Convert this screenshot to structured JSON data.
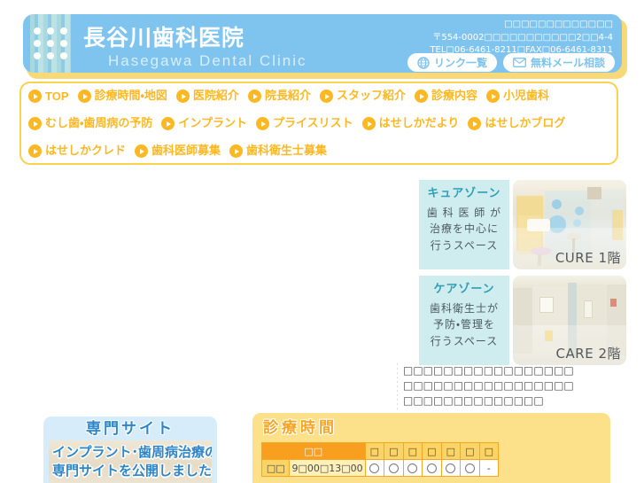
{
  "header": {
    "clinic_name_ja": "長谷川歯科医院",
    "clinic_name_en": "Hasegawa Dental Clinic",
    "address_line1": "□□□□□□□□□□□□□",
    "address_line2": "〒554-0002□□□□□□□□□□□2□□4-4",
    "address_line3": "TEL□06-6461-8211□FAX□06-6461-8311",
    "link_button": "リンク一覧",
    "mail_button": "無料メール相談"
  },
  "nav": {
    "row1": [
      {
        "label": "TOP",
        "latin": true
      },
      {
        "label": "診療時間・地図",
        "latin": false
      },
      {
        "label": "医院紹介",
        "latin": false
      },
      {
        "label": "院長紹介",
        "latin": false
      },
      {
        "label": "スタッフ紹介",
        "latin": false
      },
      {
        "label": "診療内容",
        "latin": false
      },
      {
        "label": "小児歯科",
        "latin": false
      }
    ],
    "row2": [
      {
        "label": "むし歯・歯周病の予防",
        "latin": false
      },
      {
        "label": "インプラント",
        "latin": false
      },
      {
        "label": "プライスリスト",
        "latin": false
      },
      {
        "label": "はせしかだより",
        "latin": false
      },
      {
        "label": "はせしかブログ",
        "latin": false
      }
    ],
    "row3": [
      {
        "label": "はせしかクレド",
        "latin": false
      },
      {
        "label": "歯科医師募集",
        "latin": false
      },
      {
        "label": "歯科衛生士募集",
        "latin": false
      }
    ]
  },
  "zones": [
    {
      "title": "キュアゾーン",
      "desc_lines": [
        "歯 科 医 師 が",
        "治療を中心に",
        "行うスペース"
      ],
      "caption": "CURE 1階"
    },
    {
      "title": "ケアゾーン",
      "desc_lines": [
        "歯科衛生士が",
        "予防・管理を",
        "行うスペース"
      ],
      "caption": "CARE 2階"
    }
  ],
  "note": {
    "lines": [
      "□□□□□□□□□□□□□□□□□",
      "□□□□□□□□□□□□□□□□□",
      "□□□□□□□□□□□□□□"
    ]
  },
  "banner": {
    "heading": "専門サイト",
    "line1": "インプラント･歯周病治療の",
    "line2": "専門サイトを公開しました"
  },
  "schedule": {
    "title": "診療時間",
    "corner_label": "□□",
    "day_headers": [
      "□",
      "□",
      "□",
      "□",
      "□",
      "□",
      "□"
    ],
    "rows": [
      {
        "label": "□□",
        "time": "9□00□13□00",
        "marks": [
          "○",
          "○",
          "○",
          "○",
          "○",
          "○",
          "-"
        ]
      }
    ]
  },
  "colors": {
    "header_blue": "#7fc4ee",
    "nav_orange": "#fcb823",
    "nav_border": "#fcd14f",
    "zone_cyan": "#cfedef",
    "zone_title": "#2f9fb5",
    "schedule_yellow": "#fce08a",
    "schedule_title": "#f5a623",
    "banner_blue": "#d6ecfa",
    "banner_text": "#2e86c8"
  }
}
